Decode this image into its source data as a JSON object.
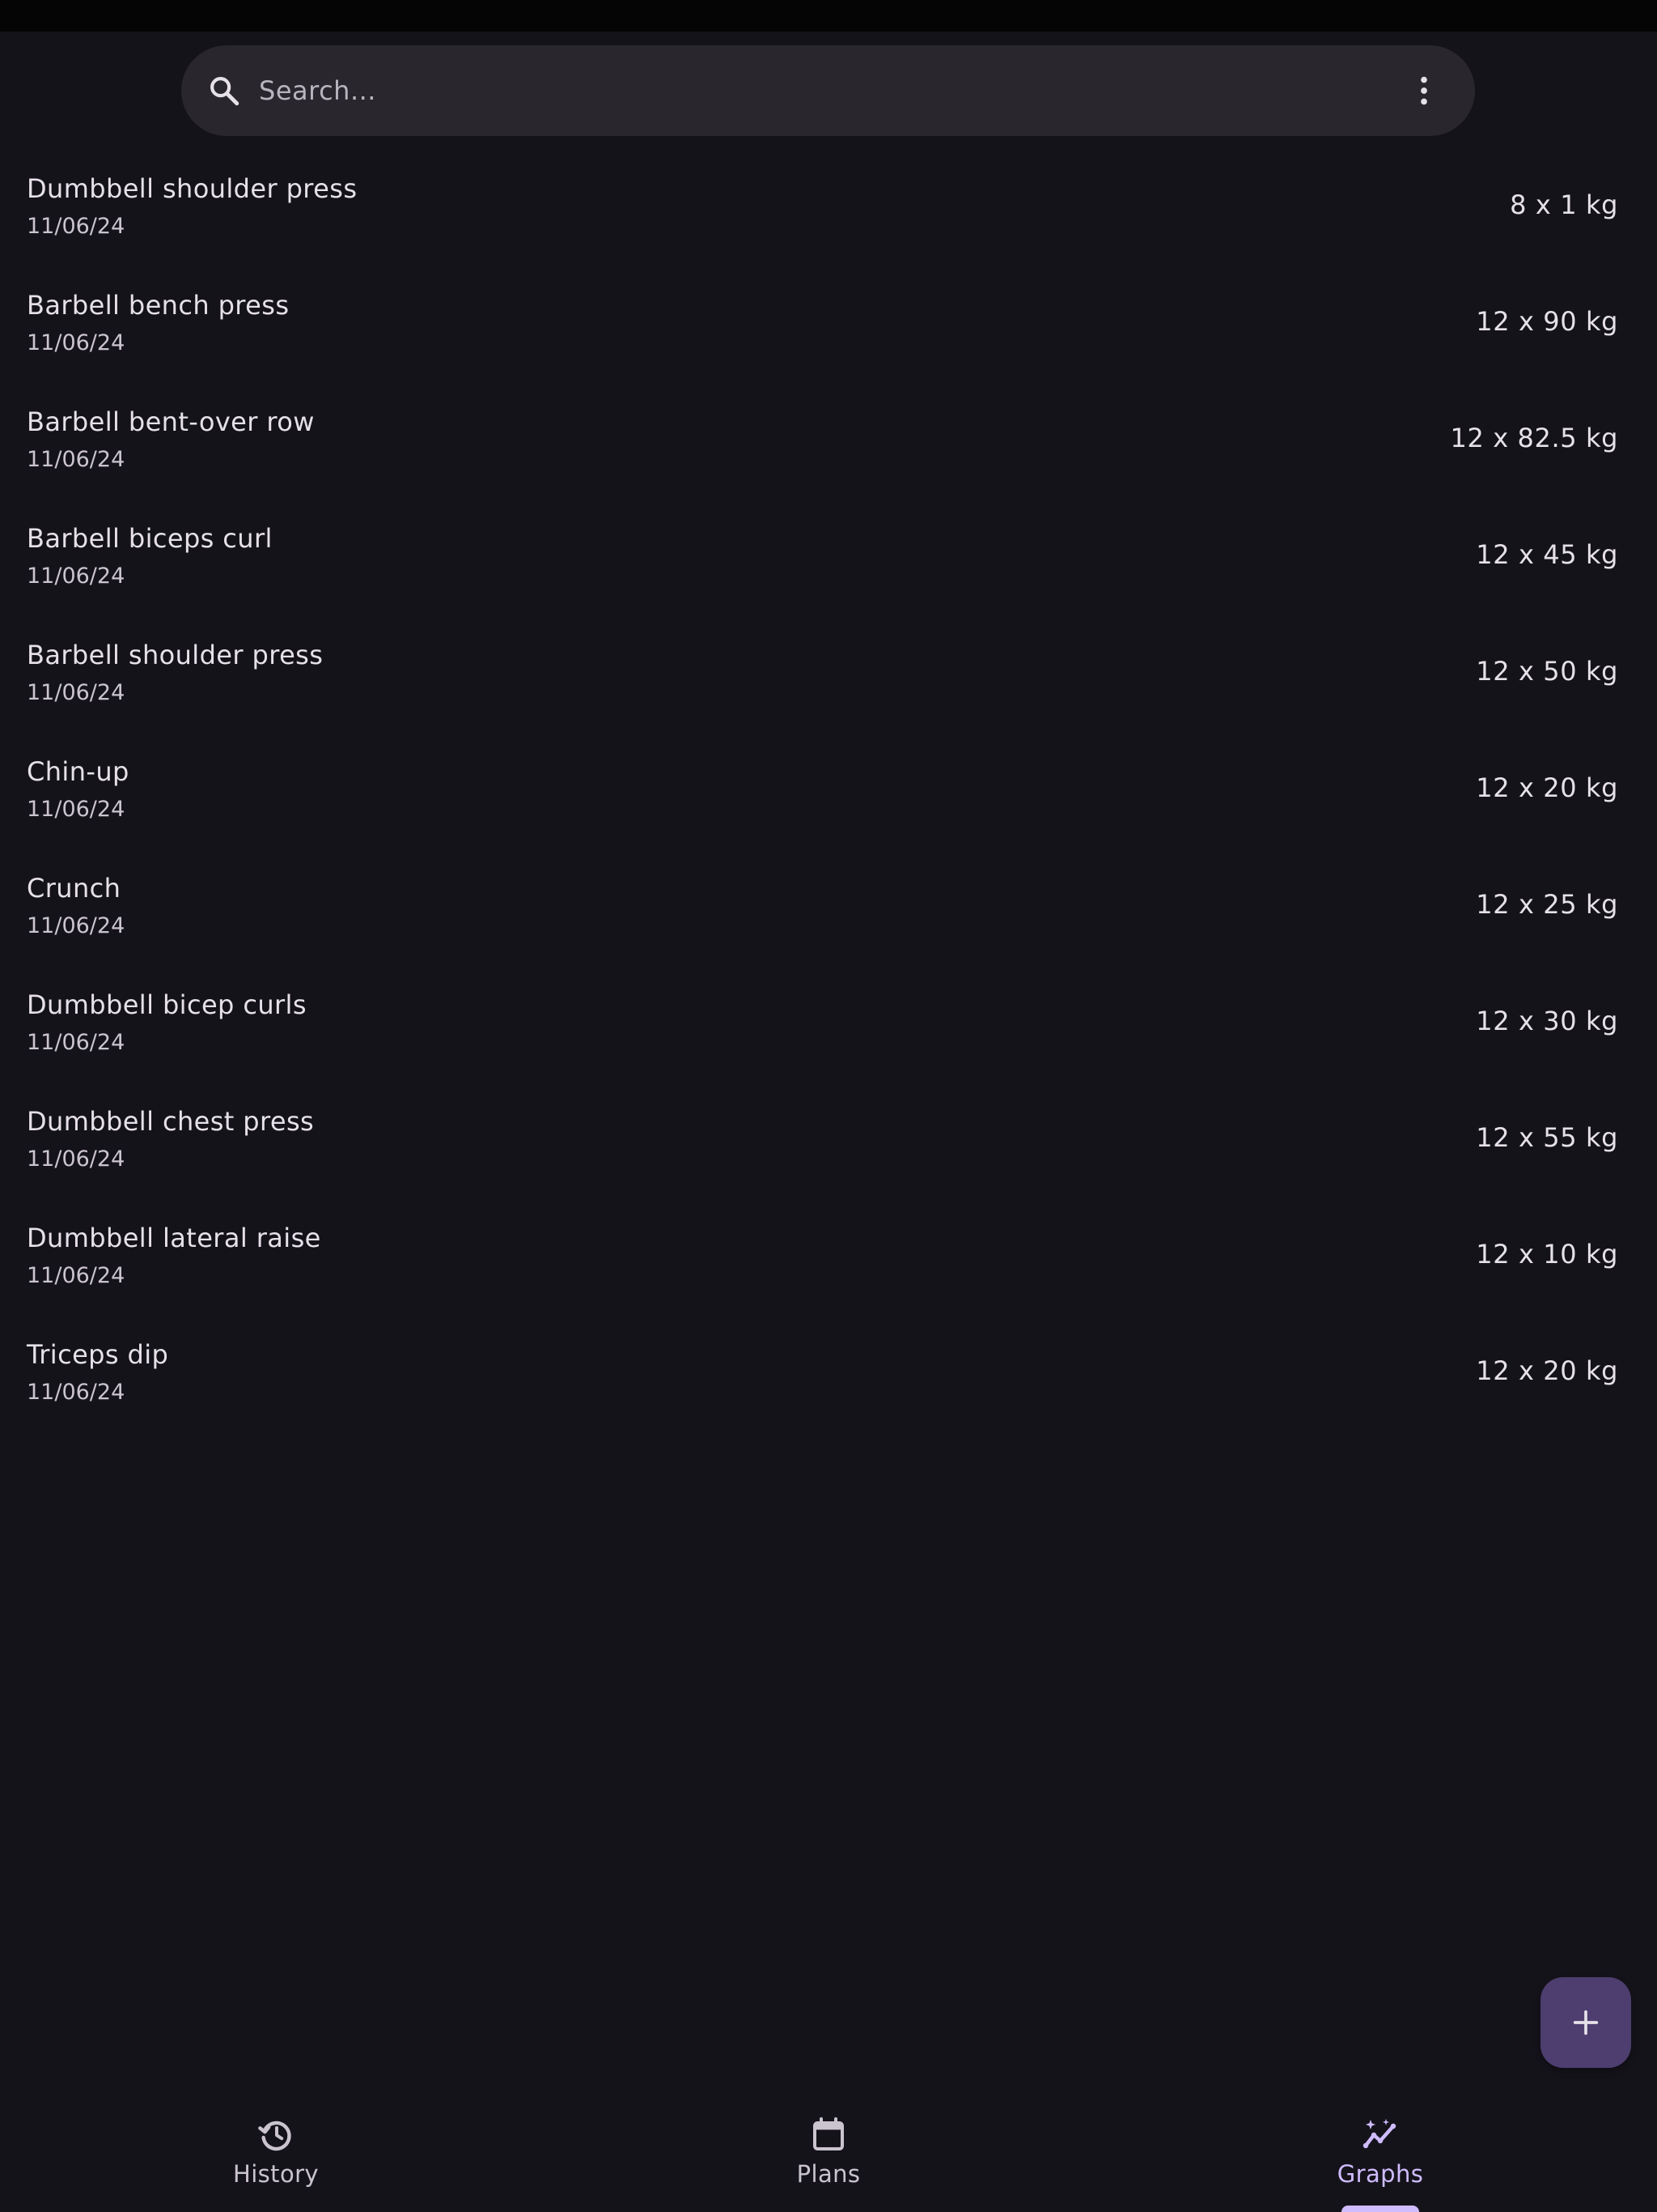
{
  "colors": {
    "background": "#15131a",
    "search_bar": "#29272d",
    "accent": "#cfbcff",
    "fab": "#4d3e6f",
    "text_primary": "#e6e1e9",
    "text_secondary": "#cac4cf"
  },
  "search": {
    "placeholder": "Search...",
    "icon": "search-icon",
    "menu_icon": "more-vert-icon"
  },
  "items": [
    {
      "name": "Dumbbell shoulder press",
      "date": "11/06/24",
      "value": "8 x 1 kg"
    },
    {
      "name": "Barbell bench press",
      "date": "11/06/24",
      "value": "12 x 90 kg"
    },
    {
      "name": "Barbell bent-over row",
      "date": "11/06/24",
      "value": "12 x 82.5 kg"
    },
    {
      "name": "Barbell biceps curl",
      "date": "11/06/24",
      "value": "12 x 45 kg"
    },
    {
      "name": "Barbell shoulder press",
      "date": "11/06/24",
      "value": "12 x 50 kg"
    },
    {
      "name": "Chin-up",
      "date": "11/06/24",
      "value": "12 x 20 kg"
    },
    {
      "name": "Crunch",
      "date": "11/06/24",
      "value": "12 x 25 kg"
    },
    {
      "name": "Dumbbell bicep curls",
      "date": "11/06/24",
      "value": "12 x 30 kg"
    },
    {
      "name": "Dumbbell chest press",
      "date": "11/06/24",
      "value": "12 x 55 kg"
    },
    {
      "name": "Dumbbell lateral raise",
      "date": "11/06/24",
      "value": "12 x 10 kg"
    },
    {
      "name": "Triceps dip",
      "date": "11/06/24",
      "value": "12 x 20 kg"
    }
  ],
  "fab": {
    "icon": "plus-icon"
  },
  "nav": {
    "history": {
      "label": "History",
      "icon": "history-icon"
    },
    "plans": {
      "label": "Plans",
      "icon": "calendar-icon"
    },
    "graphs": {
      "label": "Graphs",
      "icon": "graph-icon",
      "selected": true
    }
  }
}
